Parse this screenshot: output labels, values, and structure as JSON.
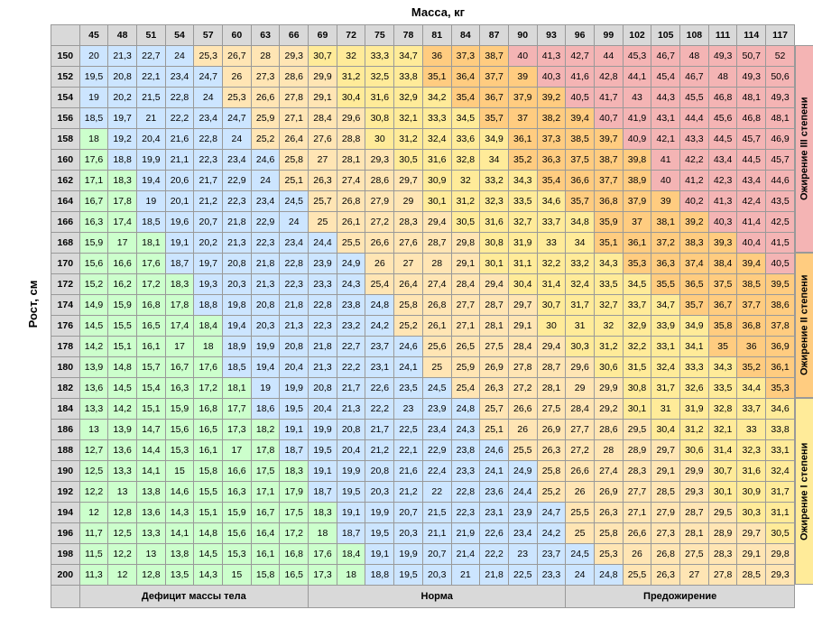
{
  "axis_top": "Масса, кг",
  "axis_left": "Рост, см",
  "weights": [
    45,
    48,
    51,
    54,
    57,
    60,
    63,
    66,
    69,
    72,
    75,
    78,
    81,
    84,
    87,
    90,
    93,
    96,
    99,
    102,
    105,
    108,
    111,
    114,
    117
  ],
  "heights": [
    150,
    152,
    154,
    156,
    158,
    160,
    162,
    164,
    166,
    168,
    170,
    172,
    174,
    176,
    178,
    180,
    182,
    184,
    186,
    188,
    190,
    192,
    194,
    196,
    198,
    200
  ],
  "categories": {
    "def": {
      "label": "Дефицит массы тела",
      "color": "#ccffcc",
      "range": [
        0,
        18.5
      ]
    },
    "nor": {
      "label": "Норма",
      "color": "#cce5ff",
      "range": [
        18.5,
        25
      ]
    },
    "pre": {
      "label": "Предожирение",
      "color": "#ffe5b4",
      "range": [
        25,
        30
      ]
    },
    "ob1": {
      "label": "Ожирение I степени",
      "color": "#ffeb99",
      "range": [
        30,
        35
      ]
    },
    "ob2": {
      "label": "Ожирение II степени",
      "color": "#ffcc80",
      "range": [
        35,
        40
      ]
    },
    "ob3": {
      "label": "Ожирение III степени",
      "color": "#f4b4b4",
      "range": [
        40,
        200
      ]
    }
  },
  "bottom_labels": [
    {
      "key": "def",
      "span": 8,
      "text": "Дефицит массы тела"
    },
    {
      "key": "nor",
      "span": 9,
      "text": "Норма"
    },
    {
      "key": "pre",
      "span": 8,
      "text": "Предожирение"
    }
  ],
  "side_labels": [
    {
      "key": "ob3",
      "text": "Ожирение III степени",
      "rows": 10,
      "color": "#f4b4b4"
    },
    {
      "key": "ob2",
      "text": "Ожирение II степени",
      "rows": 7,
      "color": "#ffcc80"
    },
    {
      "key": "ob1",
      "text": "Ожирение I степени",
      "rows": 9,
      "color": "#ffeb99"
    }
  ],
  "chart_data": {
    "type": "heatmap",
    "title": "BMI table",
    "xlabel": "Масса, кг",
    "ylabel": "Рост, см",
    "x": [
      45,
      48,
      51,
      54,
      57,
      60,
      63,
      66,
      69,
      72,
      75,
      78,
      81,
      84,
      87,
      90,
      93,
      96,
      99,
      102,
      105,
      108,
      111,
      114,
      117
    ],
    "y": [
      150,
      152,
      154,
      156,
      158,
      160,
      162,
      164,
      166,
      168,
      170,
      172,
      174,
      176,
      178,
      180,
      182,
      184,
      186,
      188,
      190,
      192,
      194,
      196,
      198,
      200
    ],
    "values": [
      [
        20,
        21.3,
        22.7,
        24,
        25.3,
        26.7,
        28,
        29.3,
        30.7,
        32,
        33.3,
        34.7,
        36,
        37.3,
        38.7,
        40,
        41.3,
        42.7,
        44,
        45.3,
        46.7,
        48,
        49.3,
        50.7,
        52
      ],
      [
        19.5,
        20.8,
        22.1,
        23.4,
        24.7,
        26,
        27.3,
        28.6,
        29.9,
        31.2,
        32.5,
        33.8,
        35.1,
        36.4,
        37.7,
        39,
        40.3,
        41.6,
        42.8,
        44.1,
        45.4,
        46.7,
        48,
        49.3,
        50.6
      ],
      [
        19,
        20.2,
        21.5,
        22.8,
        24,
        25.3,
        26.6,
        27.8,
        29.1,
        30.4,
        31.6,
        32.9,
        34.2,
        35.4,
        36.7,
        37.9,
        39.2,
        40.5,
        41.7,
        43,
        44.3,
        45.5,
        46.8,
        48.1,
        49.3
      ],
      [
        18.5,
        19.7,
        21,
        22.2,
        23.4,
        24.7,
        25.9,
        27.1,
        28.4,
        29.6,
        30.8,
        32.1,
        33.3,
        34.5,
        35.7,
        37,
        38.2,
        39.4,
        40.7,
        41.9,
        43.1,
        44.4,
        45.6,
        46.8,
        48.1
      ],
      [
        18,
        19.2,
        20.4,
        21.6,
        22.8,
        24,
        25.2,
        26.4,
        27.6,
        28.8,
        30,
        31.2,
        32.4,
        33.6,
        34.9,
        36.1,
        37.3,
        38.5,
        39.7,
        40.9,
        42.1,
        43.3,
        44.5,
        45.7,
        46.9
      ],
      [
        17.6,
        18.8,
        19.9,
        21.1,
        22.3,
        23.4,
        24.6,
        25.8,
        27,
        28.1,
        29.3,
        30.5,
        31.6,
        32.8,
        34,
        35.2,
        36.3,
        37.5,
        38.7,
        39.8,
        41,
        42.2,
        43.4,
        44.5,
        45.7
      ],
      [
        17.1,
        18.3,
        19.4,
        20.6,
        21.7,
        22.9,
        24,
        25.1,
        26.3,
        27.4,
        28.6,
        29.7,
        30.9,
        32,
        33.2,
        34.3,
        35.4,
        36.6,
        37.7,
        38.9,
        40,
        41.2,
        42.3,
        43.4,
        44.6
      ],
      [
        16.7,
        17.8,
        19,
        20.1,
        21.2,
        22.3,
        23.4,
        24.5,
        25.7,
        26.8,
        27.9,
        29,
        30.1,
        31.2,
        32.3,
        33.5,
        34.6,
        35.7,
        36.8,
        37.9,
        39,
        40.2,
        41.3,
        42.4,
        43.5
      ],
      [
        16.3,
        17.4,
        18.5,
        19.6,
        20.7,
        21.8,
        22.9,
        24,
        25,
        26.1,
        27.2,
        28.3,
        29.4,
        30.5,
        31.6,
        32.7,
        33.7,
        34.8,
        35.9,
        37,
        38.1,
        39.2,
        40.3,
        41.4,
        42.5
      ],
      [
        15.9,
        17,
        18.1,
        19.1,
        20.2,
        21.3,
        22.3,
        23.4,
        24.4,
        25.5,
        26.6,
        27.6,
        28.7,
        29.8,
        30.8,
        31.9,
        33,
        34,
        35.1,
        36.1,
        37.2,
        38.3,
        39.3,
        40.4,
        41.5
      ],
      [
        15.6,
        16.6,
        17.6,
        18.7,
        19.7,
        20.8,
        21.8,
        22.8,
        23.9,
        24.9,
        26,
        27,
        28,
        29.1,
        30.1,
        31.1,
        32.2,
        33.2,
        34.3,
        35.3,
        36.3,
        37.4,
        38.4,
        39.4,
        40.5
      ],
      [
        15.2,
        16.2,
        17.2,
        18.3,
        19.3,
        20.3,
        21.3,
        22.3,
        23.3,
        24.3,
        25.4,
        26.4,
        27.4,
        28.4,
        29.4,
        30.4,
        31.4,
        32.4,
        33.5,
        34.5,
        35.5,
        36.5,
        37.5,
        38.5,
        39.5
      ],
      [
        14.9,
        15.9,
        16.8,
        17.8,
        18.8,
        19.8,
        20.8,
        21.8,
        22.8,
        23.8,
        24.8,
        25.8,
        26.8,
        27.7,
        28.7,
        29.7,
        30.7,
        31.7,
        32.7,
        33.7,
        34.7,
        35.7,
        36.7,
        37.7,
        38.6
      ],
      [
        14.5,
        15.5,
        16.5,
        17.4,
        18.4,
        19.4,
        20.3,
        21.3,
        22.3,
        23.2,
        24.2,
        25.2,
        26.1,
        27.1,
        28.1,
        29.1,
        30,
        31,
        32,
        32.9,
        33.9,
        34.9,
        35.8,
        36.8,
        37.8
      ],
      [
        14.2,
        15.1,
        16.1,
        17,
        18,
        18.9,
        19.9,
        20.8,
        21.8,
        22.7,
        23.7,
        24.6,
        25.6,
        26.5,
        27.5,
        28.4,
        29.4,
        30.3,
        31.2,
        32.2,
        33.1,
        34.1,
        35,
        36,
        36.9
      ],
      [
        13.9,
        14.8,
        15.7,
        16.7,
        17.6,
        18.5,
        19.4,
        20.4,
        21.3,
        22.2,
        23.1,
        24.1,
        25,
        25.9,
        26.9,
        27.8,
        28.7,
        29.6,
        30.6,
        31.5,
        32.4,
        33.3,
        34.3,
        35.2,
        36.1
      ],
      [
        13.6,
        14.5,
        15.4,
        16.3,
        17.2,
        18.1,
        19,
        19.9,
        20.8,
        21.7,
        22.6,
        23.5,
        24.5,
        25.4,
        26.3,
        27.2,
        28.1,
        29,
        29.9,
        30.8,
        31.7,
        32.6,
        33.5,
        34.4,
        35.3
      ],
      [
        13.3,
        14.2,
        15.1,
        15.9,
        16.8,
        17.7,
        18.6,
        19.5,
        20.4,
        21.3,
        22.2,
        23,
        23.9,
        24.8,
        25.7,
        26.6,
        27.5,
        28.4,
        29.2,
        30.1,
        31,
        31.9,
        32.8,
        33.7,
        34.6
      ],
      [
        13,
        13.9,
        14.7,
        15.6,
        16.5,
        17.3,
        18.2,
        19.1,
        19.9,
        20.8,
        21.7,
        22.5,
        23.4,
        24.3,
        25.1,
        26,
        26.9,
        27.7,
        28.6,
        29.5,
        30.4,
        31.2,
        32.1,
        33,
        33.8
      ],
      [
        12.7,
        13.6,
        14.4,
        15.3,
        16.1,
        17,
        17.8,
        18.7,
        19.5,
        20.4,
        21.2,
        22.1,
        22.9,
        23.8,
        24.6,
        25.5,
        26.3,
        27.2,
        28,
        28.9,
        29.7,
        30.6,
        31.4,
        32.3,
        33.1
      ],
      [
        12.5,
        13.3,
        14.1,
        15,
        15.8,
        16.6,
        17.5,
        18.3,
        19.1,
        19.9,
        20.8,
        21.6,
        22.4,
        23.3,
        24.1,
        24.9,
        25.8,
        26.6,
        27.4,
        28.3,
        29.1,
        29.9,
        30.7,
        31.6,
        32.4
      ],
      [
        12.2,
        13,
        13.8,
        14.6,
        15.5,
        16.3,
        17.1,
        17.9,
        18.7,
        19.5,
        20.3,
        21.2,
        22,
        22.8,
        23.6,
        24.4,
        25.2,
        26,
        26.9,
        27.7,
        28.5,
        29.3,
        30.1,
        30.9,
        31.7
      ],
      [
        12,
        12.8,
        13.6,
        14.3,
        15.1,
        15.9,
        16.7,
        17.5,
        18.3,
        19.1,
        19.9,
        20.7,
        21.5,
        22.3,
        23.1,
        23.9,
        24.7,
        25.5,
        26.3,
        27.1,
        27.9,
        28.7,
        29.5,
        30.3,
        31.1
      ],
      [
        11.7,
        12.5,
        13.3,
        14.1,
        14.8,
        15.6,
        16.4,
        17.2,
        18,
        18.7,
        19.5,
        20.3,
        21.1,
        21.9,
        22.6,
        23.4,
        24.2,
        25,
        25.8,
        26.6,
        27.3,
        28.1,
        28.9,
        29.7,
        30.5
      ],
      [
        11.5,
        12.2,
        13,
        13.8,
        14.5,
        15.3,
        16.1,
        16.8,
        17.6,
        18.4,
        19.1,
        19.9,
        20.7,
        21.4,
        22.2,
        23,
        23.7,
        24.5,
        25.3,
        26,
        26.8,
        27.5,
        28.3,
        29.1,
        29.8
      ],
      [
        11.3,
        12,
        12.8,
        13.5,
        14.3,
        15,
        15.8,
        16.5,
        17.3,
        18,
        18.8,
        19.5,
        20.3,
        21,
        21.8,
        22.5,
        23.3,
        24,
        24.8,
        25.5,
        26.3,
        27,
        27.8,
        28.5,
        29.3
      ]
    ]
  }
}
